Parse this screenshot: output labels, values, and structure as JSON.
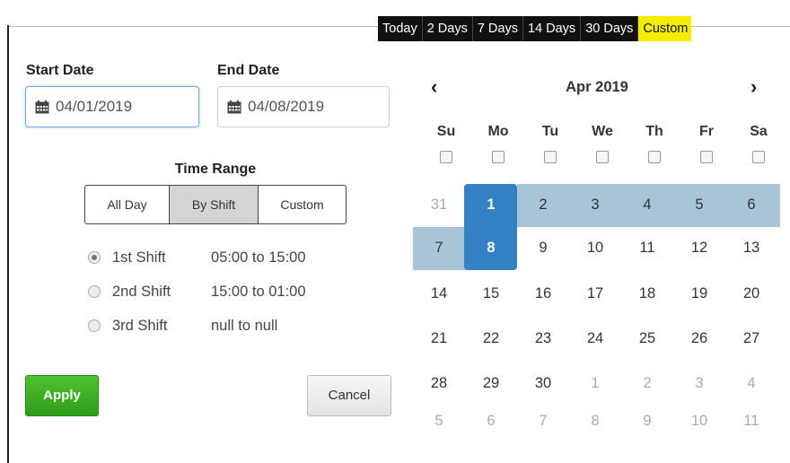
{
  "range_tabs": [
    {
      "label": "Today",
      "active": false
    },
    {
      "label": "2 Days",
      "active": false
    },
    {
      "label": "7 Days",
      "active": false
    },
    {
      "label": "14 Days",
      "active": false
    },
    {
      "label": "30 Days",
      "active": false
    },
    {
      "label": "Custom",
      "active": true
    }
  ],
  "form": {
    "start_label": "Start Date",
    "start_value": "04/01/2019",
    "end_label": "End Date",
    "end_value": "04/08/2019",
    "time_range_label": "Time Range",
    "segments": [
      {
        "label": "All Day",
        "active": false
      },
      {
        "label": "By Shift",
        "active": true
      },
      {
        "label": "Custom",
        "active": false
      }
    ],
    "shifts": [
      {
        "name": "1st Shift",
        "time": "05:00 to 15:00",
        "checked": true
      },
      {
        "name": "2nd Shift",
        "time": "15:00 to 01:00",
        "checked": false
      },
      {
        "name": "3rd Shift",
        "time": "null to null",
        "checked": false
      }
    ],
    "apply_label": "Apply",
    "cancel_label": "Cancel"
  },
  "calendar": {
    "prev_icon": "‹",
    "next_icon": "›",
    "month": "Apr 2019",
    "weekdays": [
      "Su",
      "Mo",
      "Tu",
      "We",
      "Th",
      "Fr",
      "Sa"
    ],
    "weeks": [
      [
        "31",
        "1",
        "2",
        "3",
        "4",
        "5",
        "6"
      ],
      [
        "7",
        "8",
        "9",
        "10",
        "11",
        "12",
        "13"
      ],
      [
        "14",
        "15",
        "16",
        "17",
        "18",
        "19",
        "20"
      ],
      [
        "21",
        "22",
        "23",
        "24",
        "25",
        "26",
        "27"
      ],
      [
        "28",
        "29",
        "30",
        "1",
        "2",
        "3",
        "4"
      ],
      [
        "5",
        "6",
        "7",
        "8",
        "9",
        "10",
        "11"
      ]
    ],
    "range_start": "1",
    "range_end": "8"
  },
  "colors": {
    "selected": "#3380c4",
    "in_range": "#a8c5d6",
    "active_tab": "#f5ec00",
    "apply": "#3aa822"
  }
}
